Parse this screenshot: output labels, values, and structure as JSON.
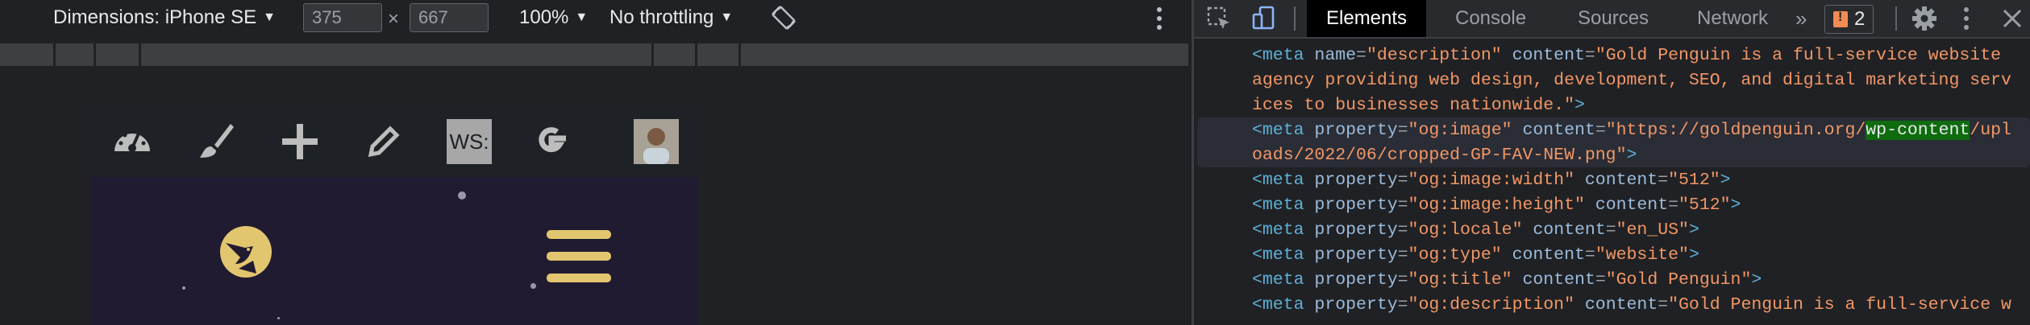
{
  "device_toolbar": {
    "dimensions_label": "Dimensions: iPhone SE",
    "width": "375",
    "times": "×",
    "height": "667",
    "zoom": "100%",
    "throttling": "No throttling"
  },
  "colors": {
    "brand_yellow": "#e2c66f",
    "page_bg": "#211b31",
    "adminbar_bg": "#1e2226"
  },
  "adminbar": {
    "icons": [
      "dashboard-icon",
      "customize-brush-icon",
      "new-plus-icon",
      "edit-pencil-icon",
      "ws-icon",
      "google-icon",
      "user-avatar"
    ],
    "ws_text": "WS:"
  },
  "devtools": {
    "tabs": [
      "Elements",
      "Console",
      "Sources",
      "Network"
    ],
    "active_tab": "Elements",
    "more_tabs": "»",
    "issues_count": "2"
  },
  "dom_lines": [
    {
      "tag": "<meta",
      "a1": "name",
      "v1": "\"description\"",
      "a2": "content",
      "v2": "\"Gold Penguin is a full-service website"
    },
    {
      "cont": "agency providing web design, development, SEO, and digital marketing serv"
    },
    {
      "cont": "ices to businesses nationwide.\"",
      "close": ">"
    },
    {
      "tag": "<meta",
      "a1": "property",
      "v1": "\"og:image\"",
      "a2": "content",
      "v2a": "\"https://goldpenguin.org/",
      "v2hl": "wp-content",
      "v2b": "/upl"
    },
    {
      "cont": "oads/2022/06/cropped-GP-FAV-NEW.png\"",
      "close": ">"
    },
    {
      "tag": "<meta",
      "a1": "property",
      "v1": "\"og:image:width\"",
      "a2": "content",
      "v2": "\"512\"",
      "close": ">"
    },
    {
      "tag": "<meta",
      "a1": "property",
      "v1": "\"og:image:height\"",
      "a2": "content",
      "v2": "\"512\"",
      "close": ">"
    },
    {
      "tag": "<meta",
      "a1": "property",
      "v1": "\"og:locale\"",
      "a2": "content",
      "v2": "\"en_US\"",
      "close": ">"
    },
    {
      "tag": "<meta",
      "a1": "property",
      "v1": "\"og:type\"",
      "a2": "content",
      "v2": "\"website\"",
      "close": ">"
    },
    {
      "tag": "<meta",
      "a1": "property",
      "v1": "\"og:title\"",
      "a2": "content",
      "v2": "\"Gold Penguin\"",
      "close": ">"
    },
    {
      "tag": "<meta",
      "a1": "property",
      "v1": "\"og:description\"",
      "a2": "content",
      "v2": "\"Gold Penguin is a full-service w"
    }
  ]
}
